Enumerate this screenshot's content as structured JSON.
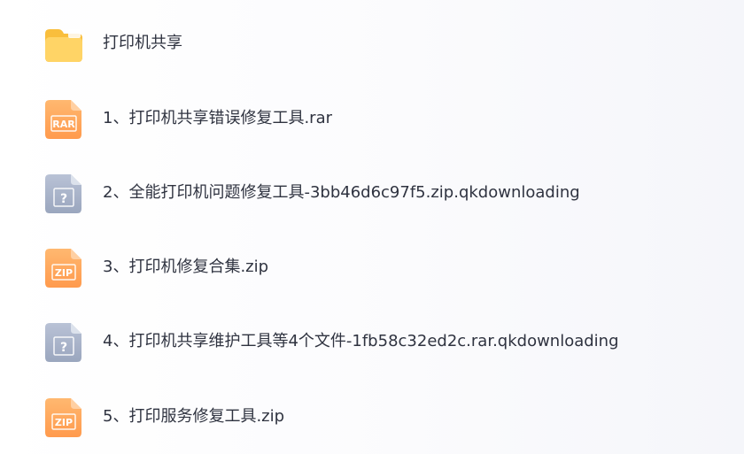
{
  "files": [
    {
      "name": "打印机共享",
      "icon": "folder-icon"
    },
    {
      "name": "1、打印机共享错误修复工具.rar",
      "icon": "rar-file-icon",
      "badge": "RAR"
    },
    {
      "name": "2、全能打印机问题修复工具-3bb46d6c97f5.zip.qkdownloading",
      "icon": "unknown-file-icon",
      "badge": "?"
    },
    {
      "name": "3、打印机修复合集.zip",
      "icon": "zip-file-icon",
      "badge": "ZIP"
    },
    {
      "name": "4、打印机共享维护工具等4个文件-1fb58c32ed2c.rar.qkdownloading",
      "icon": "unknown-file-icon",
      "badge": "?"
    },
    {
      "name": "5、打印服务修复工具.zip",
      "icon": "zip-file-icon",
      "badge": "ZIP"
    }
  ],
  "colors": {
    "folder": "#FFD466",
    "archive": "#FFA65C",
    "unknown": "#A9B4CA",
    "text": "#2F3340"
  }
}
